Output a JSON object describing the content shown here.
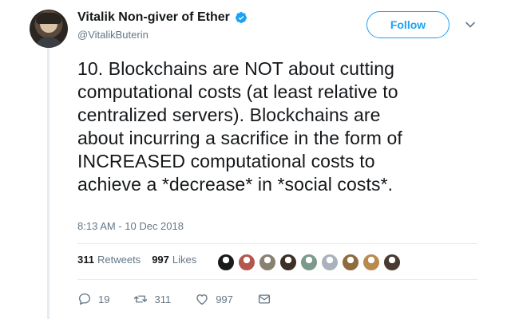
{
  "author": {
    "display_name": "Vitalik Non-giver of Ether",
    "handle": "@VitalikButerin",
    "verified": true
  },
  "follow_label": "Follow",
  "tweet_text": "10. Blockchains are NOT about cutting\ncomputational costs (at least relative to\ncentralized servers). Blockchains are\nabout incurring a sacrifice in the form of\nINCREASED computational costs to\nachieve a *decrease* in *social costs*.",
  "timestamp": "8:13 AM - 10 Dec 2018",
  "stats": {
    "retweets_count": "311",
    "retweets_label": "Retweets",
    "likes_count": "997",
    "likes_label": "Likes"
  },
  "likers": [
    {
      "color": "#1b1b1b"
    },
    {
      "color": "#b4574f"
    },
    {
      "color": "#8a8070"
    },
    {
      "color": "#3d3026"
    },
    {
      "color": "#7b9a8c"
    },
    {
      "color": "#aab3bd"
    },
    {
      "color": "#8f6b3f"
    },
    {
      "color": "#b98a4e"
    },
    {
      "color": "#4a3a30"
    }
  ],
  "actions": {
    "reply_count": "19",
    "retweet_count": "311",
    "like_count": "997"
  },
  "colors": {
    "accent": "#1da1f2",
    "secondary_text": "#657786",
    "divider": "#e6ecf0"
  }
}
